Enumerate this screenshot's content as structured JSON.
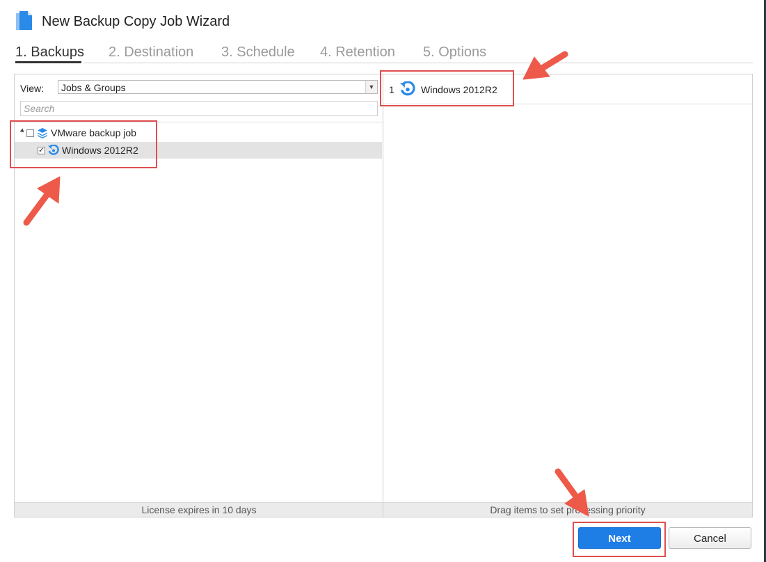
{
  "window": {
    "title": "New Backup Copy Job Wizard"
  },
  "steps": [
    {
      "label": "1. Backups",
      "active": true
    },
    {
      "label": "2. Destination",
      "active": false
    },
    {
      "label": "3. Schedule",
      "active": false
    },
    {
      "label": "4. Retention",
      "active": false
    },
    {
      "label": "5. Options",
      "active": false
    }
  ],
  "left_panel": {
    "view_label": "View:",
    "view_value": "Jobs & Groups",
    "search_placeholder": "Search",
    "tree": [
      {
        "label": "VMware backup job",
        "checked": false,
        "icon": "layers-icon",
        "expanded": true
      },
      {
        "label": "Windows 2012R2",
        "checked": true,
        "icon": "backup-refresh-icon",
        "selected": true
      }
    ],
    "footer": "License expires in 10 days"
  },
  "right_panel": {
    "items": [
      {
        "index": "1",
        "label": "Windows 2012R2",
        "icon": "backup-refresh-icon"
      }
    ],
    "footer": "Drag items to set processing priority"
  },
  "buttons": {
    "next": "Next",
    "cancel": "Cancel"
  },
  "colors": {
    "accent": "#1f7de6",
    "highlight": "#e04e4e",
    "arrow": "#ee5a4a"
  }
}
